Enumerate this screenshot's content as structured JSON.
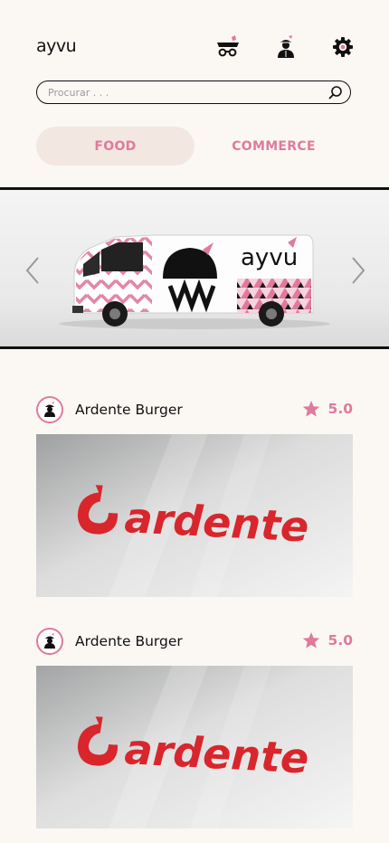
{
  "app": {
    "logo_text": "ayvu"
  },
  "header": {
    "icons": [
      "cart-icon",
      "profile-icon",
      "settings-gear-icon"
    ]
  },
  "search": {
    "placeholder": "Procurar . . .",
    "value": "",
    "icon": "search-icon"
  },
  "tabs": [
    {
      "label": "FOOD",
      "active": true
    },
    {
      "label": "COMMERCE",
      "active": false
    }
  ],
  "hero": {
    "van_logo_text": "ayvu",
    "prev_icon": "chevron-left-icon",
    "next_icon": "chevron-right-icon"
  },
  "cards": [
    {
      "name": "Ardente Burger",
      "rating": "5.0",
      "image_text": "ardente"
    },
    {
      "name": "Ardente Burger",
      "rating": "5.0",
      "image_text": "ardente"
    }
  ],
  "colors": {
    "accent": "#e07a9c",
    "background": "#fbf8f4",
    "tab_active_bg": "#f3e7e2",
    "brand_red": "#d8262c"
  }
}
